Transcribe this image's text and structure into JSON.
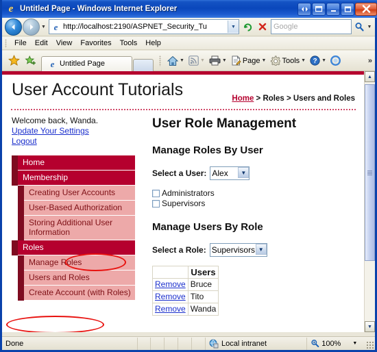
{
  "window": {
    "title": "Untitled Page - Windows Internet Explorer",
    "app_icon": "ie-logo-icon",
    "buttons": {
      "restore_group": "◂▸",
      "restore_window": "❐",
      "minimize": "_",
      "maximize": "□",
      "close": "✕"
    }
  },
  "addressbar": {
    "back": "◀",
    "forward": "▶",
    "history_caret": "▼",
    "url": "http://localhost:2190/ASPNET_Security_Tu",
    "url_caret": "▼",
    "refresh_icon": "refresh-icon",
    "stop_icon": "stop-icon",
    "search_placeholder": "Google",
    "search_value": "",
    "search_caret": "▼"
  },
  "menubar": {
    "items": [
      "File",
      "Edit",
      "View",
      "Favorites",
      "Tools",
      "Help"
    ]
  },
  "commandbar": {
    "favorites_icon": "star-icon",
    "add_favorites_icon": "add-to-favorites-icon",
    "tab_label": "Untitled Page",
    "home": "home-icon",
    "feeds": "rss-feed-icon",
    "print": "print-icon",
    "page_label": "Page",
    "tools_label": "Tools",
    "help_icon": "help-icon",
    "safety_icon": "blue-circle-icon",
    "overflow": "»"
  },
  "page": {
    "site_title": "User Account Tutorials",
    "breadcrumb": {
      "home": "Home",
      "rest": " > Roles > Users and Roles"
    },
    "left": {
      "welcome": "Welcome back, Wanda.",
      "update_settings": "Update Your Settings",
      "logout": "Logout",
      "nav": [
        {
          "label": "Home",
          "level": "top"
        },
        {
          "label": "Membership",
          "level": "top"
        },
        {
          "label": "Creating User Accounts",
          "level": "sub"
        },
        {
          "label": "User-Based Authorization",
          "level": "sub"
        },
        {
          "label": "Storing Additional User Information",
          "level": "sub"
        },
        {
          "label": "Roles",
          "level": "top"
        },
        {
          "label": "Manage Roles",
          "level": "sub"
        },
        {
          "label": "Users and Roles",
          "level": "sub"
        },
        {
          "label": "Create Account (with Roles)",
          "level": "sub"
        }
      ]
    },
    "main": {
      "heading": "User Role Management",
      "section1_heading": "Manage Roles By User",
      "select_user_label": "Select a User:",
      "selected_user": "Alex",
      "user_options": [
        "Alex"
      ],
      "role_checkboxes": [
        {
          "label": "Administrators",
          "checked": false
        },
        {
          "label": "Supervisors",
          "checked": false
        }
      ],
      "section2_heading": "Manage Users By Role",
      "select_role_label": "Select a Role:",
      "selected_role": "Supervisors",
      "role_options": [
        "Supervisors"
      ],
      "users_table": {
        "columns": [
          "",
          "Users"
        ],
        "rows": [
          {
            "action": "Remove",
            "user": "Bruce"
          },
          {
            "action": "Remove",
            "user": "Tito"
          },
          {
            "action": "Remove",
            "user": "Wanda"
          }
        ]
      }
    }
  },
  "statusbar": {
    "status": "Done",
    "zone_icon": "local-intranet-icon",
    "zone": "Local intranet",
    "zoom_icon": "zoom-icon",
    "zoom": "100%",
    "zoom_caret": "▼"
  },
  "colors": {
    "brand_red": "#b5002e",
    "nav_accent": "#7e0b20",
    "nav_sub_bg": "#eda9a9",
    "nav_sub_text": "#7e1016",
    "link_blue": "#1a2ecc",
    "annotation_red": "#e8110e",
    "title_blue": "#0a47bb"
  }
}
